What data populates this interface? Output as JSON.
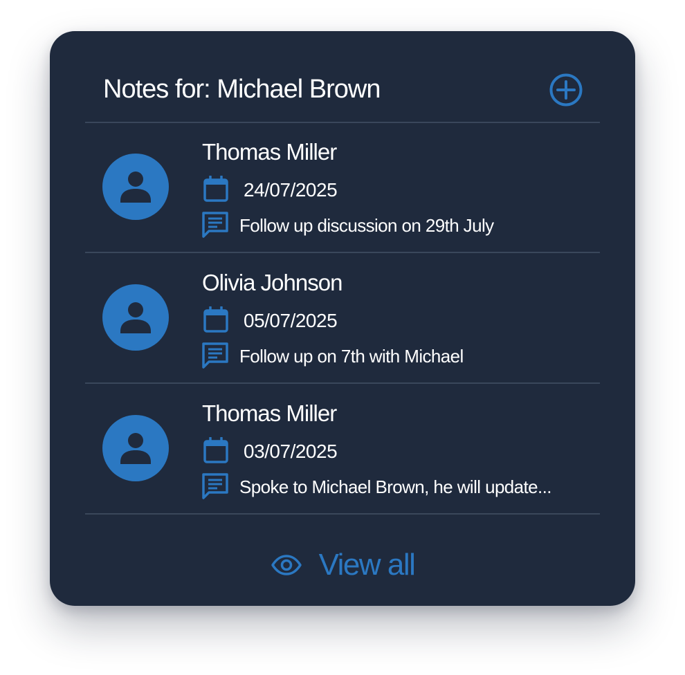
{
  "header": {
    "title": "Notes for: Michael Brown",
    "add_icon": "plus-circle-icon"
  },
  "notes": [
    {
      "author": "Thomas Miller",
      "date": "24/07/2025",
      "text": "Follow up discussion on 29th July"
    },
    {
      "author": "Olivia Johnson",
      "date": "05/07/2025",
      "text": "Follow up on 7th with Michael"
    },
    {
      "author": "Thomas Miller",
      "date": "03/07/2025",
      "text": "Spoke to Michael Brown, he will update..."
    }
  ],
  "footer": {
    "view_all_label": "View all",
    "view_icon": "eye-icon"
  },
  "colors": {
    "card_background": "#1f2a3d",
    "accent": "#2b78c2",
    "divider": "#3a475b",
    "text": "#ffffff"
  }
}
